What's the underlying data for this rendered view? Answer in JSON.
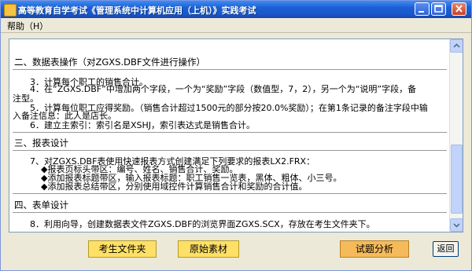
{
  "window": {
    "title": "高等教育自学考试《管理系统中计算机应用（上机）》实践考试"
  },
  "menu": {
    "help": "帮助（H）"
  },
  "content": {
    "lines": [
      "二、数据表操作（对ZGXS.DBF文件进行操作）",
      "3．计算每个职工的销售合计。",
      "4．在“ZGXS.DBF”中增加两个字段，一个为“奖励”字段（数值型，7，2），另一个为“说明”字段，备",
      "注型。",
      "5．计算每位职工应得奖励。（销售合计超过1500元的部分按20.0%奖励）；在第1条记录的备注字段中输",
      "入备注信息：此人是店长。",
      "6．建立主索引：索引名是XSHJ，索引表达式是销售合计。",
      "三、报表设计",
      "7、对ZGXS.DBF表使用快速报表方式创建满足下列要求的报表LX2.FRX：",
      "◆报表页标头带区：编号、姓名、销售合计、奖励。",
      "◆添加报表标题带区，输入报表标题：职工销售一览表，黑体、粗体、小三号。",
      "◆添加报表总结带区，分别使用域控件计算销售合计和奖励的合计值。",
      "四、表单设计",
      "8．利用向导，创建数据表文件ZGXS.DBF的浏览界面ZGXS.SCX，存放在考生文件夹下。"
    ]
  },
  "buttons": {
    "student_folder": "考生文件夹",
    "source_material": "原始素材",
    "analysis": "试题分析",
    "back": "返回"
  },
  "colors": {
    "titlebar": "#1c5fd4",
    "yellow_button": "#ffe066",
    "orange_button": "#f5ba5a"
  },
  "icons": {
    "minimize": "minimize-icon",
    "maximize": "maximize-icon",
    "close": "close-icon"
  }
}
